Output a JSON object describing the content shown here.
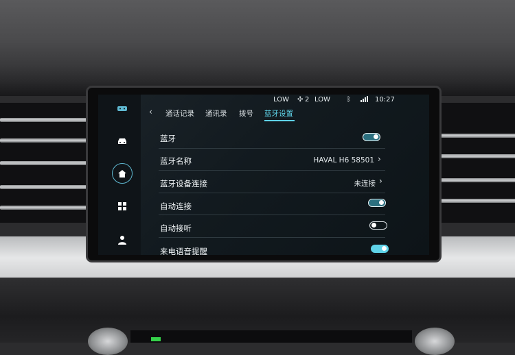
{
  "status_bar": {
    "left_temp": "LOW",
    "fan": "2",
    "right_temp": "LOW",
    "time": "10:27"
  },
  "tabs": [
    {
      "label": "通话记录",
      "active": false
    },
    {
      "label": "通讯录",
      "active": false
    },
    {
      "label": "拨号",
      "active": false
    },
    {
      "label": "蓝牙设置",
      "active": true
    }
  ],
  "settings": [
    {
      "label": "蓝牙",
      "type": "toggle",
      "on": true
    },
    {
      "label": "蓝牙名称",
      "type": "value",
      "value": "HAVAL H6 58501"
    },
    {
      "label": "蓝牙设备连接",
      "type": "value",
      "value": "未连接"
    },
    {
      "label": "自动连接",
      "type": "toggle",
      "on": true
    },
    {
      "label": "自动接听",
      "type": "toggle",
      "on": false
    },
    {
      "label": "来电语音提醒",
      "type": "toggle",
      "on": true
    }
  ],
  "sidebar": {
    "items": [
      "car-icon",
      "home-icon",
      "apps-grid-icon",
      "person-icon"
    ],
    "active": "home-icon"
  },
  "colors": {
    "accent": "#5fd3e8",
    "screen_bg": "#141b20"
  }
}
